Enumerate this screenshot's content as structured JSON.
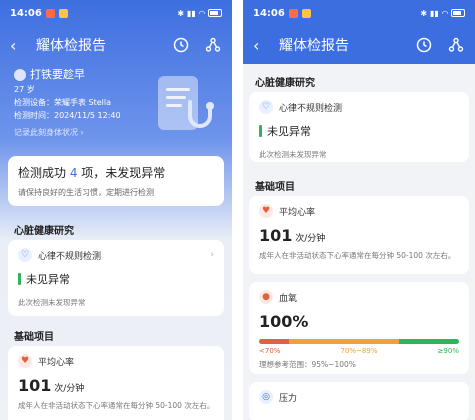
{
  "status_bar": {
    "time": "14:06"
  },
  "header": {
    "title": "耀体检报告"
  },
  "left": {
    "user": {
      "name": "打铁要趁早",
      "age": "27 岁",
      "device": "检测设备：荣耀手表 Stella",
      "time": "检测时间：2024/11/5 12:40",
      "record_link": "记录此刻身体状况 ›"
    },
    "summary": {
      "prefix": "检测成功 ",
      "count": "4",
      "suffix": " 项，未发现异常",
      "advice": "请保持良好的生活习惯，定期进行检测"
    },
    "heart_section": "心脏健康研究",
    "heart_item": {
      "label": "心律不规则检测",
      "status": "未见异常",
      "note": "此次检测未发现异常"
    },
    "basic_section": "基础项目",
    "hr_item": {
      "label": "平均心率",
      "value": "101",
      "unit": " 次/分钟",
      "desc": "成年人在非活动状态下心率通常在每分钟 50-100 次左右。"
    }
  },
  "right": {
    "heart_section": "心脏健康研究",
    "heart_item": {
      "label": "心律不规则检测",
      "status": "未见异常",
      "note": "此次检测未发现异常"
    },
    "basic_section": "基础项目",
    "hr_item": {
      "label": "平均心率",
      "value": "101",
      "unit": " 次/分钟",
      "desc": "成年人在非活动状态下心率通常在每分钟 50-100 次左右。"
    },
    "spo2_item": {
      "label": "血氧",
      "value": "100%",
      "ticks": [
        "<70%",
        "70%~89%",
        "≥90%"
      ],
      "reference": "理想参考范围：95%~100%"
    },
    "stress_item": {
      "label": "压力"
    }
  },
  "colors": {
    "accent": "#3d6ee0",
    "normal": "#2fb35b",
    "warn": "#f1a03a",
    "danger": "#e06040"
  }
}
